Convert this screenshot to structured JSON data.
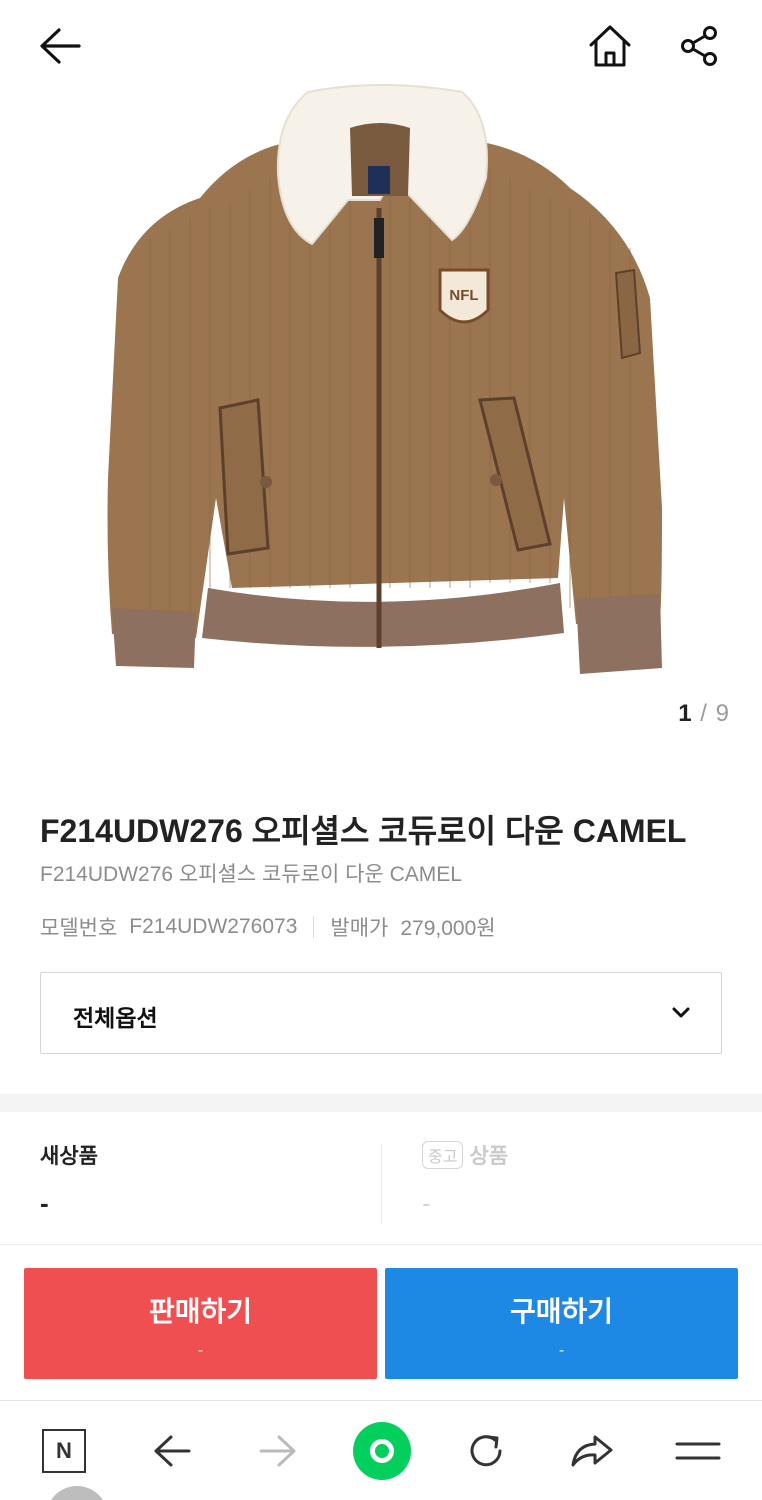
{
  "header": {
    "back_icon": "arrow-left-icon",
    "home_icon": "home-icon",
    "share_icon": "share-icon"
  },
  "gallery": {
    "current": "1",
    "separator": "/",
    "total": "9",
    "patch_text": "NFL"
  },
  "product": {
    "title": "F214UDW276 오피셜스 코듀로이 다운 CAMEL",
    "subtitle": "F214UDW276 오피셜스 코듀로이 다운 CAMEL",
    "model_label": "모델번호",
    "model_value": "F214UDW276073",
    "release_label": "발매가",
    "release_value": "279,000원"
  },
  "options": {
    "selected": "전체옵션",
    "chevron_icon": "chevron-down-icon"
  },
  "prices": {
    "new_label": "새상품",
    "new_value": "-",
    "used_badge": "중고",
    "used_label": "상품",
    "used_value": "-"
  },
  "actions": {
    "sell_label": "판매하기",
    "sell_sub": "-",
    "buy_label": "구매하기",
    "buy_sub": "-"
  },
  "browser_bar": {
    "home_letter": "N",
    "items": [
      "naver-home-icon",
      "back-arrow-icon",
      "forward-arrow-icon",
      "green-circle-icon",
      "reload-icon",
      "share-arrow-icon",
      "menu-icon"
    ]
  },
  "colors": {
    "sell": "#ef4f50",
    "buy": "#1e88e5",
    "green": "#03cf5d"
  }
}
